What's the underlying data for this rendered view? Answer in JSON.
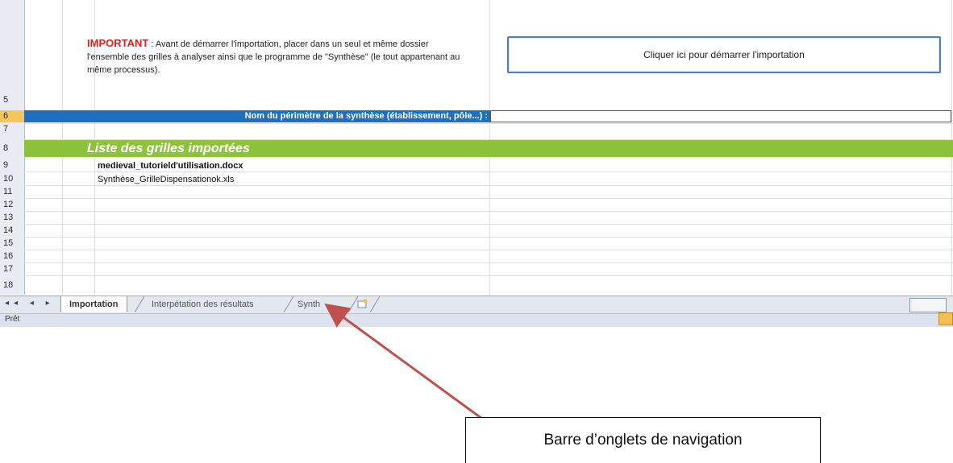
{
  "rows": [
    "5",
    "6",
    "7",
    "8",
    "9",
    "10",
    "11",
    "12",
    "13",
    "14",
    "15",
    "16",
    "17",
    "18"
  ],
  "important": {
    "label": "IMPORTANT",
    "text": " : Avant de démarrer l'importation, placer dans un seul et même dossier l'ensemble des grilles à analyser ainsi que le programme de \"Synthèse\" (le tout appartenant au même processus)."
  },
  "import_button": {
    "label": "Cliquer ici pour démarrer l'importation"
  },
  "perimeter": {
    "label": "Nom du périmètre de la synthèse (établissement, pôle...) :",
    "value": ""
  },
  "list": {
    "title": "Liste des grilles importées",
    "files": [
      "medieval_tutorield'utilisation.docx",
      "Synthèse_GrilleDispensationok.xls"
    ]
  },
  "tabs": [
    {
      "label": "Importation",
      "active": true
    },
    {
      "label": "Interpétation des résultats",
      "active": false
    },
    {
      "label": "Synth",
      "active": false
    }
  ],
  "nav_buttons": "◂◂ ◂ ▸ ▸▸",
  "status": {
    "text": "Prêt"
  },
  "callout": {
    "text": "Barre d’onglets de navigation"
  },
  "colors": {
    "header_blue": "#1f6fbf",
    "list_green": "#8dc23d",
    "important_red": "#e0201a",
    "arrow": "#c0504d"
  }
}
